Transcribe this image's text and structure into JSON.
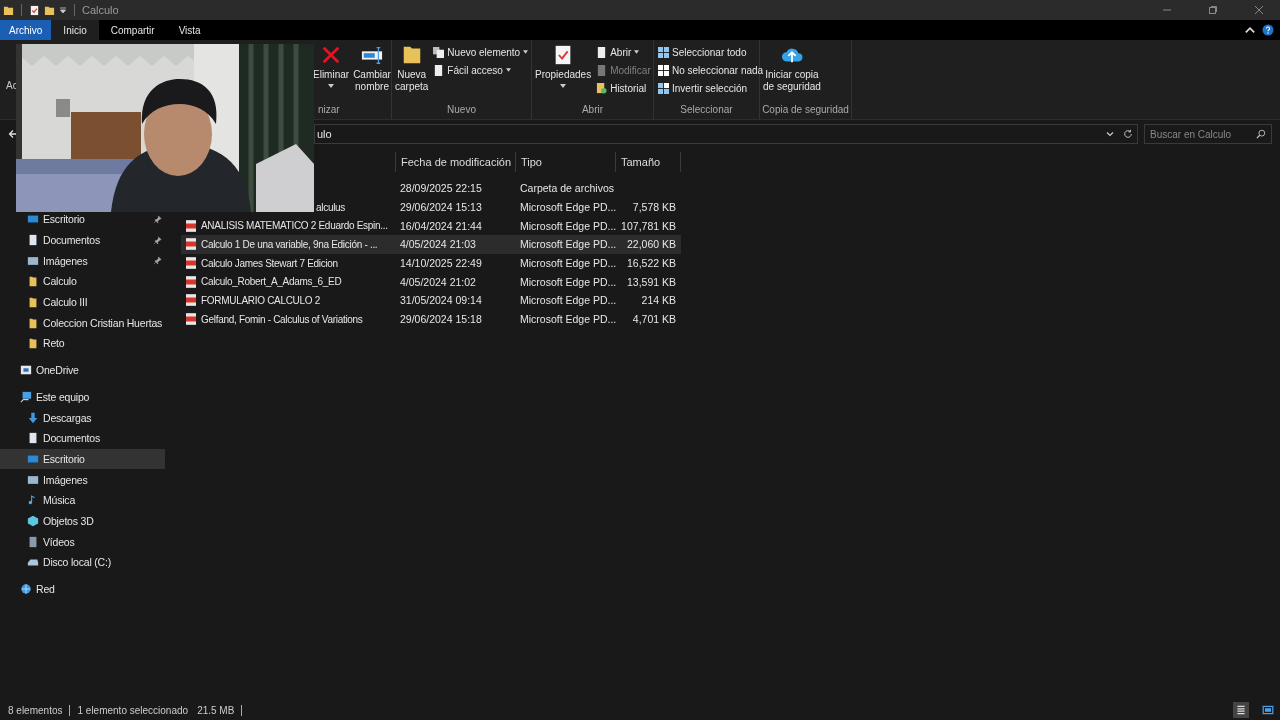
{
  "window": {
    "title": "Calculo"
  },
  "tabs": [
    {
      "label": "Archivo",
      "kind": "file",
      "selected": false
    },
    {
      "label": "Inicio",
      "kind": "tab",
      "selected": true
    },
    {
      "label": "Compartir",
      "kind": "tab",
      "selected": false
    },
    {
      "label": "Vista",
      "kind": "tab",
      "selected": false
    }
  ],
  "ribbon": {
    "cut_label": "Ac",
    "groups": [
      {
        "label": "nizar",
        "buttons": [
          {
            "kind": "large",
            "label": "Eliminar",
            "has_menu": true,
            "disabled": false
          },
          {
            "kind": "large",
            "label": "Cambiar\nnombre",
            "has_menu": false,
            "disabled": false
          }
        ]
      },
      {
        "label": "Nuevo",
        "buttons": [
          {
            "kind": "large",
            "label": "Nueva\ncarpeta",
            "has_menu": false,
            "disabled": false
          },
          {
            "kind": "small",
            "label": "Nuevo elemento",
            "has_menu": true,
            "disabled": false
          },
          {
            "kind": "small",
            "label": "Fácil acceso",
            "has_menu": true,
            "disabled": false
          }
        ]
      },
      {
        "label": "Abrir",
        "buttons": [
          {
            "kind": "large",
            "label": "Propiedades",
            "has_menu": true,
            "disabled": false
          },
          {
            "kind": "small",
            "label": "Abrir",
            "has_menu": true,
            "disabled": false
          },
          {
            "kind": "small",
            "label": "Modificar",
            "has_menu": false,
            "disabled": true
          },
          {
            "kind": "small",
            "label": "Historial",
            "has_menu": false,
            "disabled": false
          }
        ]
      },
      {
        "label": "Seleccionar",
        "buttons": [
          {
            "kind": "small",
            "label": "Seleccionar todo",
            "has_menu": false,
            "disabled": false
          },
          {
            "kind": "small",
            "label": "No seleccionar nada",
            "has_menu": false,
            "disabled": false
          },
          {
            "kind": "small",
            "label": "Invertir selección",
            "has_menu": false,
            "disabled": false
          }
        ]
      },
      {
        "label": "Copia de seguridad",
        "buttons": [
          {
            "kind": "large",
            "label": "Iniciar copia\nde seguridad",
            "has_menu": false,
            "disabled": false
          }
        ]
      }
    ]
  },
  "address": {
    "path": "ulo",
    "search": {
      "placeholder": "Buscar en Calculo"
    }
  },
  "nav": {
    "quick_access": [
      {
        "label": "Escritorio",
        "kind": "desktop",
        "pinned": true,
        "selected": false
      },
      {
        "label": "Documentos",
        "kind": "documents",
        "pinned": true,
        "selected": false
      },
      {
        "label": "Imágenes",
        "kind": "pictures",
        "pinned": true,
        "selected": false
      },
      {
        "label": "Calculo",
        "kind": "folder",
        "pinned": false,
        "selected": false
      },
      {
        "label": "Calculo III",
        "kind": "folder",
        "pinned": false,
        "selected": false
      },
      {
        "label": "Coleccion Cristian Huertas",
        "kind": "folder",
        "pinned": false,
        "selected": false
      },
      {
        "label": "Reto",
        "kind": "folder",
        "pinned": false,
        "selected": false
      }
    ],
    "sections": [
      {
        "label": "OneDrive",
        "kind": "cloud",
        "selected": false
      },
      {
        "label": "Este equipo",
        "kind": "pc",
        "selected": false,
        "children": [
          {
            "label": "Descargas",
            "kind": "downloads",
            "selected": false
          },
          {
            "label": "Documentos",
            "kind": "documents",
            "selected": false
          },
          {
            "label": "Escritorio",
            "kind": "desktop",
            "selected": true
          },
          {
            "label": "Imágenes",
            "kind": "pictures",
            "selected": false
          },
          {
            "label": "Música",
            "kind": "music",
            "selected": false
          },
          {
            "label": "Objetos 3D",
            "kind": "cube",
            "selected": false
          },
          {
            "label": "Vídeos",
            "kind": "videos",
            "selected": false
          },
          {
            "label": "Disco local (C:)",
            "kind": "drive",
            "selected": false
          }
        ]
      },
      {
        "label": "Red",
        "kind": "network",
        "selected": false
      }
    ]
  },
  "table": {
    "columns": [
      "Fecha de modificación",
      "Tipo",
      "Tamaño"
    ],
    "rows": [
      {
        "date": "28/09/2025 22:15",
        "type": "Carpeta de archivos",
        "selected": false
      },
      {
        "name": "alculus",
        "date": "29/06/2024 15:13",
        "type": "Microsoft Edge PD...",
        "size": "7,578 KB",
        "selected": false
      },
      {
        "name": "ANALISIS MATEMATICO 2 Eduardo Espin...",
        "kind": "pdf",
        "date": "16/04/2024 21:44",
        "type": "Microsoft Edge PD...",
        "size": "107,781 KB",
        "selected": false
      },
      {
        "name": "Calculo 1 De una variable, 9na Edición - ...",
        "kind": "pdf",
        "date": "4/05/2024 21:03",
        "type": "Microsoft Edge PD...",
        "size": "22,060 KB",
        "selected": true
      },
      {
        "name": "Calculo James Stewart 7 Edicion",
        "kind": "pdf",
        "date": "14/10/2025 22:49",
        "type": "Microsoft Edge PD...",
        "size": "16,522 KB",
        "selected": false
      },
      {
        "name": "Calculo_Robert_A_Adams_6_ED",
        "kind": "pdf",
        "date": "4/05/2024 21:02",
        "type": "Microsoft Edge PD...",
        "size": "13,591 KB",
        "selected": false
      },
      {
        "name": "FORMULARIO CALCULO 2",
        "kind": "pdf",
        "date": "31/05/2024 09:14",
        "type": "Microsoft Edge PD...",
        "size": "214 KB",
        "selected": false
      },
      {
        "name": "Gelfand, Fomin - Calculus of Variations",
        "kind": "pdf",
        "date": "29/06/2024 15:18",
        "type": "Microsoft Edge PD...",
        "size": "4,701 KB",
        "selected": false
      }
    ]
  },
  "status_bar": {
    "count": "8 elementos",
    "selection": "1 elemento seleccionado",
    "size": "21.5 MB",
    "views": [
      {
        "kind": "details",
        "selected": true
      },
      {
        "kind": "icons",
        "selected": false
      }
    ]
  }
}
